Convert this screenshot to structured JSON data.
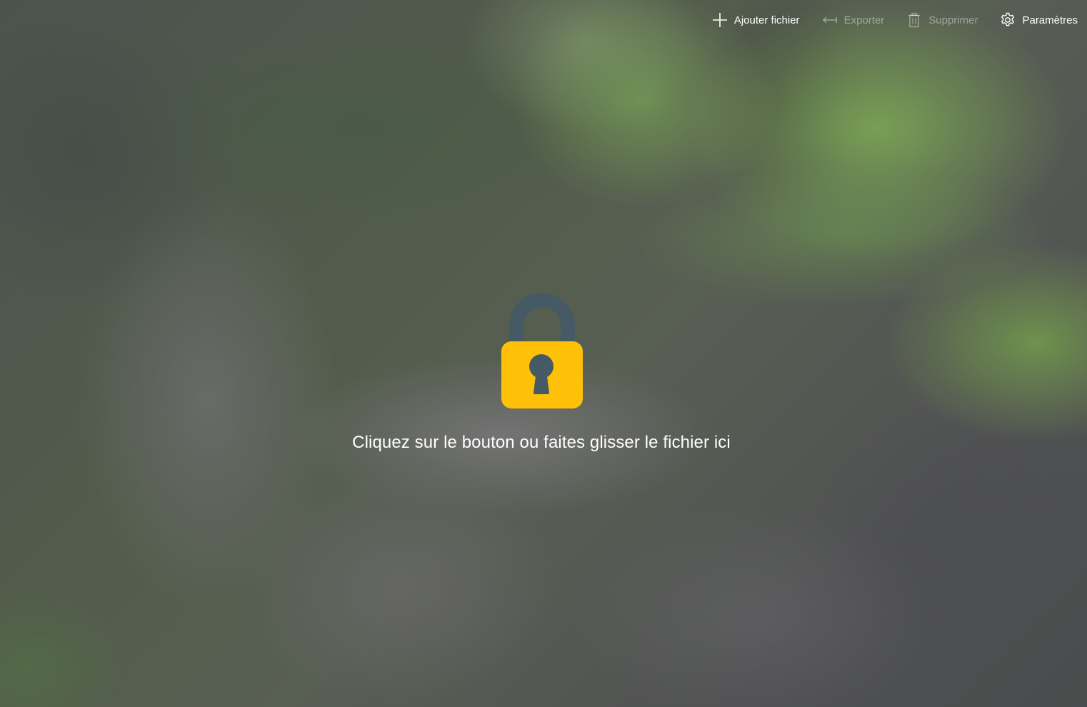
{
  "toolbar": {
    "add_file": {
      "label": "Ajouter fichier",
      "icon": "plus-icon",
      "enabled": true
    },
    "export": {
      "label": "Exporter",
      "icon": "arrow-left-icon",
      "enabled": false
    },
    "delete": {
      "label": "Supprimer",
      "icon": "trash-icon",
      "enabled": false
    },
    "settings": {
      "label": "Paramètres",
      "icon": "gear-icon",
      "enabled": true
    }
  },
  "main": {
    "lock_icon": "padlock-icon",
    "hint": "Cliquez sur le bouton ou faites glisser le fichier ici"
  },
  "colors": {
    "lock_body": "#FFC107",
    "lock_shackle": "#455A64",
    "text": "#FFFFFF"
  }
}
